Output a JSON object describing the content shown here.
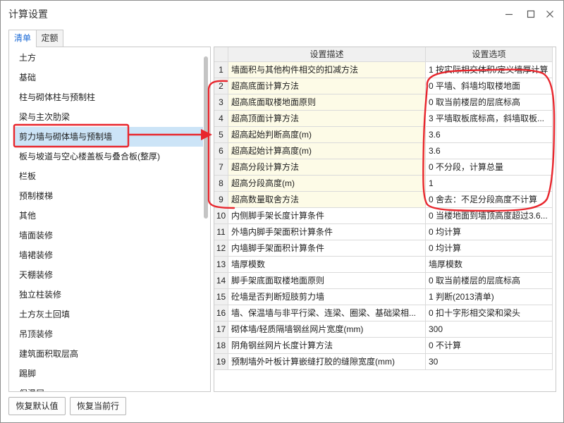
{
  "window": {
    "title": "计算设置",
    "controls": [
      {
        "icon": "minimize-icon"
      },
      {
        "icon": "maximize-icon"
      },
      {
        "icon": "close-icon"
      }
    ]
  },
  "tabs": [
    {
      "label": "清单",
      "selected": true
    },
    {
      "label": "定额",
      "selected": false
    }
  ],
  "category_list": {
    "selected_index": 4,
    "items": [
      "土方",
      "基础",
      "柱与砌体柱与预制柱",
      "梁与主次肋梁",
      "剪力墙与砌体墙与预制墙",
      "板与坡道与空心楼盖板与叠合板(整厚)",
      "栏板",
      "预制楼梯",
      "其他",
      "墙面装修",
      "墙裙装修",
      "天棚装修",
      "独立柱装修",
      "土方灰土回填",
      "吊顶装修",
      "建筑面积取层高",
      "踢脚",
      "保温层"
    ]
  },
  "settings_table": {
    "header": {
      "description": "设置描述",
      "option": "设置选项"
    },
    "rows": [
      {
        "no": 1,
        "description": "墙面积与其他构件相交的扣减方法",
        "option": "1 按实际相交体积/定义墙厚计算"
      },
      {
        "no": 2,
        "description": "超高底面计算方法",
        "option": "0 平墙、斜墙均取楼地面"
      },
      {
        "no": 3,
        "description": "超高底面取楼地面原则",
        "option": "0 取当前楼层的层底标高"
      },
      {
        "no": 4,
        "description": "超高顶面计算方法",
        "option": "3 平墙取板底标高，斜墙取板..."
      },
      {
        "no": 5,
        "description": "超高起始判断高度(m)",
        "option": "3.6"
      },
      {
        "no": 6,
        "description": "超高起始计算高度(m)",
        "option": "3.6"
      },
      {
        "no": 7,
        "description": "超高分段计算方法",
        "option": "0 不分段，计算总量"
      },
      {
        "no": 8,
        "description": "超高分段高度(m)",
        "option": "1"
      },
      {
        "no": 9,
        "description": "超高数量取舍方法",
        "option": "0 舍去：不足分段高度不计算"
      },
      {
        "no": 10,
        "description": "内侧脚手架长度计算条件",
        "option": "0 当楼地面到墙顶高度超过3.6..."
      },
      {
        "no": 11,
        "description": "外墙内脚手架面积计算条件",
        "option": "0 均计算"
      },
      {
        "no": 12,
        "description": "内墙脚手架面积计算条件",
        "option": "0 均计算"
      },
      {
        "no": 13,
        "description": "墙厚模数",
        "option": "墙厚模数"
      },
      {
        "no": 14,
        "description": "脚手架底面取楼地面原则",
        "option": "0 取当前楼层的层底标高"
      },
      {
        "no": 15,
        "description": "砼墙是否判断短肢剪力墙",
        "option": "1 判断(2013清单)"
      },
      {
        "no": 16,
        "description": "墙、保温墙与非平行梁、连梁、圈梁、基础梁相...",
        "option": "0 扣十字形相交梁和梁头"
      },
      {
        "no": 17,
        "description": "砌体墙/轻质隔墙钢丝网片宽度(mm)",
        "option": "300"
      },
      {
        "no": 18,
        "description": "阴角钢丝网片长度计算方法",
        "option": "0 不计算"
      },
      {
        "no": 19,
        "description": "预制墙外叶板计算嵌缝打胶的缝隙宽度(mm)",
        "option": "30"
      }
    ]
  },
  "buttons": {
    "restore_default": "恢复默认值",
    "restore_current_row": "恢复当前行"
  },
  "colors": {
    "accent": "#1b6ad6",
    "selection": "#cce4f7",
    "row_highlight": "#fdfbe7",
    "annotation": "#e8262d"
  }
}
